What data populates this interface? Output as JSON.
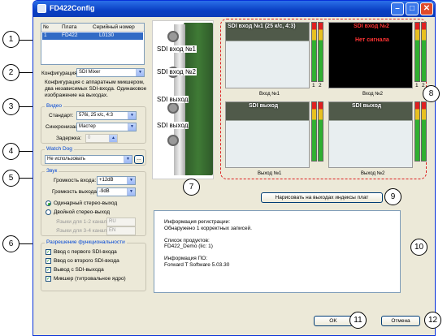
{
  "window": {
    "title": "FD422Config"
  },
  "table": {
    "headers": [
      "№",
      "Плата",
      "Серийный номер"
    ],
    "row": [
      "1",
      "FD422",
      "L0130"
    ]
  },
  "config": {
    "label": "Конфигурация:",
    "value": "SDI Mixer",
    "description": "Конфигурация с аппаратным микшером, два независимых SDI-входа. Одинаковое изображение на выходах."
  },
  "video": {
    "title": "Видео",
    "standard_label": "Стандарт:",
    "standard_value": "576i, 25 к/с, 4:3",
    "sync_label": "Синхронизация:",
    "sync_value": "Мастер",
    "delay_label": "Задержка:",
    "delay_value": "0"
  },
  "watchdog": {
    "title": "Watch Dog",
    "value": "Не использовать",
    "extra": "..."
  },
  "sound": {
    "title": "Звук",
    "input_label": "Громкость входа:",
    "input_value": "+12dB",
    "output_label": "Громкость выхода:",
    "output_value": "-9dB",
    "mono": "Одинарный стерео-выход",
    "dual": "Двойной стерео-выход",
    "ch12_label": "Языки для 1-2 каналов:",
    "ch12_value": "RU",
    "ch34_label": "Языки для 3-4 каналов:",
    "ch34_value": "EN"
  },
  "functions": {
    "title": "Разрешение функциональности",
    "items": [
      "Ввод с первого SDI-входа",
      "Ввод со второго SDI-входа",
      "Вывод с SDI-выхода",
      "Микшер (титровальное ядро)"
    ]
  },
  "board": {
    "labels": [
      "SDI вход №1",
      "SDI вход №2",
      "SDI выход",
      "SDI выход"
    ]
  },
  "previews": [
    {
      "overlay": "SDI вход №1 (25 к/с, 4:3)",
      "caption": "Вход №1",
      "signal": ""
    },
    {
      "overlay": "SDI вход №2",
      "caption": "Вход №2",
      "signal": "Нет сигнала"
    },
    {
      "overlay": "SDI выход",
      "caption": "Выход №1",
      "signal": ""
    },
    {
      "overlay": "SDI выход",
      "caption": "Выход №2",
      "signal": ""
    }
  ],
  "meter": {
    "ch1": "1",
    "ch2": "2"
  },
  "actions": {
    "draw_label": "Нарисовать на выходах индексы плат",
    "ok": "OK",
    "cancel": "Отмена"
  },
  "info": {
    "text": "Информация регистрации:\nОбнаружено 1 корректных записей.\n\nСписок продуктов:\nFD422_Demo (lic: 1)\n\nИнформация ПО:\nForward T Software 5.03.30"
  },
  "callouts": [
    "1",
    "2",
    "3",
    "4",
    "5",
    "6",
    "7",
    "8",
    "9",
    "10",
    "11",
    "12"
  ]
}
